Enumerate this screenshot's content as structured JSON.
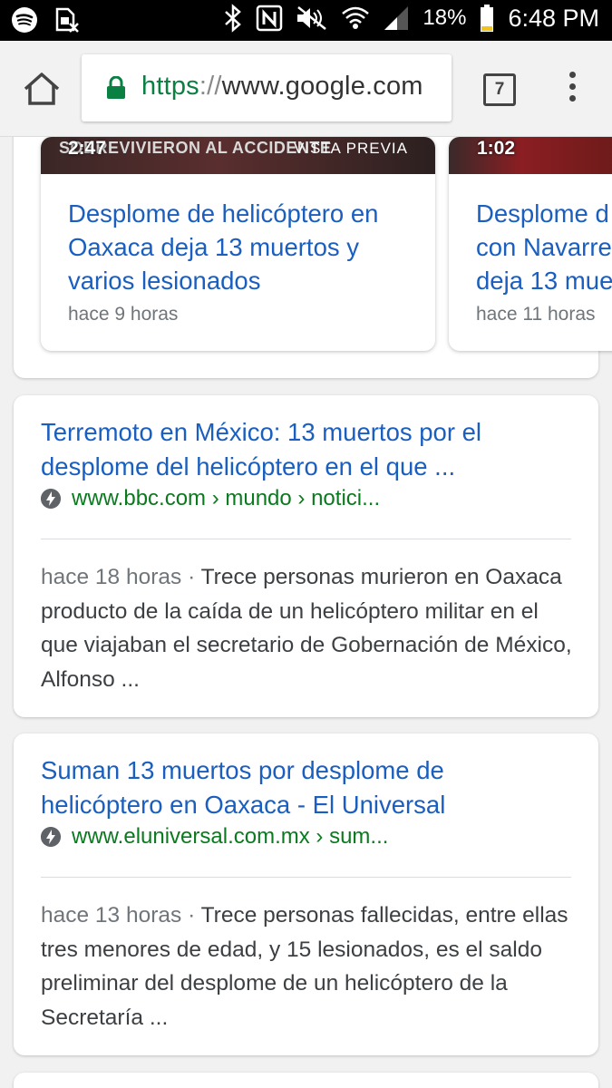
{
  "status_bar": {
    "battery_percent": "18%",
    "time": "6:48 PM",
    "icons": [
      "spotify-icon",
      "no-sim-icon",
      "bluetooth-icon",
      "nfc-icon",
      "mute-icon",
      "wifi-icon",
      "signal-icon",
      "battery-icon"
    ]
  },
  "toolbar": {
    "url_scheme": "https",
    "url_sep": "://",
    "url_host": "www.google.com",
    "tab_count": "7"
  },
  "videos": [
    {
      "duration": "2:47",
      "caption": "SOBREVIVIERON AL ACCIDENTE",
      "preview_label": "VISTA PREVIA",
      "title": "Desplome de helicóptero en Oaxaca deja 13 muertos y varios lesionados",
      "time": "hace 9 horas"
    },
    {
      "duration": "1:02",
      "title_lines": [
        "Desplome d",
        "con Navarre",
        "deja 13 mue"
      ],
      "time": "hace 11 horas"
    }
  ],
  "results": [
    {
      "title": "Terremoto en México: 13 muertos por el desplome del helicóptero en el que ...",
      "url": "www.bbc.com › mundo › notici...",
      "date": "hace 18 horas",
      "sep": " · ",
      "snippet": "Trece personas murieron en Oaxaca producto de la caída de un helicóptero militar en el que viajaban el secretario de Gobernación de México, Alfonso ..."
    },
    {
      "title": "Suman 13 muertos por desplome de helicóptero en Oaxaca - El Universal",
      "url": "www.eluniversal.com.mx › sum...",
      "date": "hace 13 horas",
      "sep": " · ",
      "snippet": "Trece personas fallecidas, entre ellas tres menores de edad, y 15 lesionados, es el saldo preliminar del desplome de un helicóptero de la Secretaría ..."
    }
  ],
  "colors": {
    "link": "#1a5fc0",
    "url_green": "#0b7a1f",
    "secure_green": "#0b8043"
  }
}
